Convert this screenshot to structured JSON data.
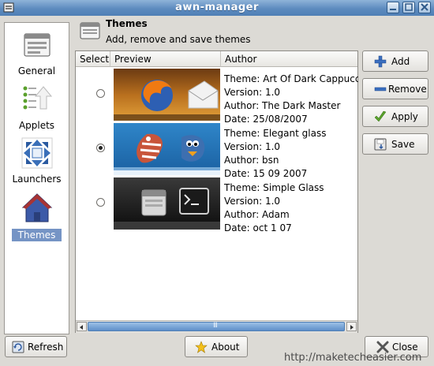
{
  "window": {
    "title": "awn-manager"
  },
  "sidebar": {
    "items": [
      {
        "label": "General",
        "icon": "general-window-icon",
        "selected": false
      },
      {
        "label": "Applets",
        "icon": "applets-list-icon",
        "selected": false
      },
      {
        "label": "Launchers",
        "icon": "launchers-arrows-icon",
        "selected": false
      },
      {
        "label": "Themes",
        "icon": "house-icon",
        "selected": true
      }
    ]
  },
  "header": {
    "title": "Themes",
    "subtitle": "Add, remove and save themes"
  },
  "list": {
    "columns": [
      "Select",
      "Preview",
      "Author"
    ],
    "rows": [
      {
        "selected": false,
        "lines": [
          "Theme: Art Of Dark Cappuccino",
          "Version: 1.0",
          "Author: The Dark Master",
          "Date: 25/08/2007"
        ]
      },
      {
        "selected": true,
        "lines": [
          "Theme: Elegant glass",
          "Version: 1.0",
          "Author: bsn",
          "Date: 15 09 2007"
        ]
      },
      {
        "selected": false,
        "lines": [
          "Theme: Simple Glass",
          "Version: 1.0",
          "Author: Adam",
          "Date: oct 1 07"
        ]
      }
    ],
    "scrollbar_grip": "III"
  },
  "buttons": {
    "add": "Add",
    "remove": "Remove",
    "apply": "Apply",
    "save": "Save",
    "refresh": "Refresh",
    "about": "About",
    "close": "Close"
  },
  "watermark": "http://maketecheasier.com",
  "colors": {
    "titlebar": "#5d8bbf",
    "selection": "#7594c5",
    "row_highlight": "#3f86c8"
  }
}
